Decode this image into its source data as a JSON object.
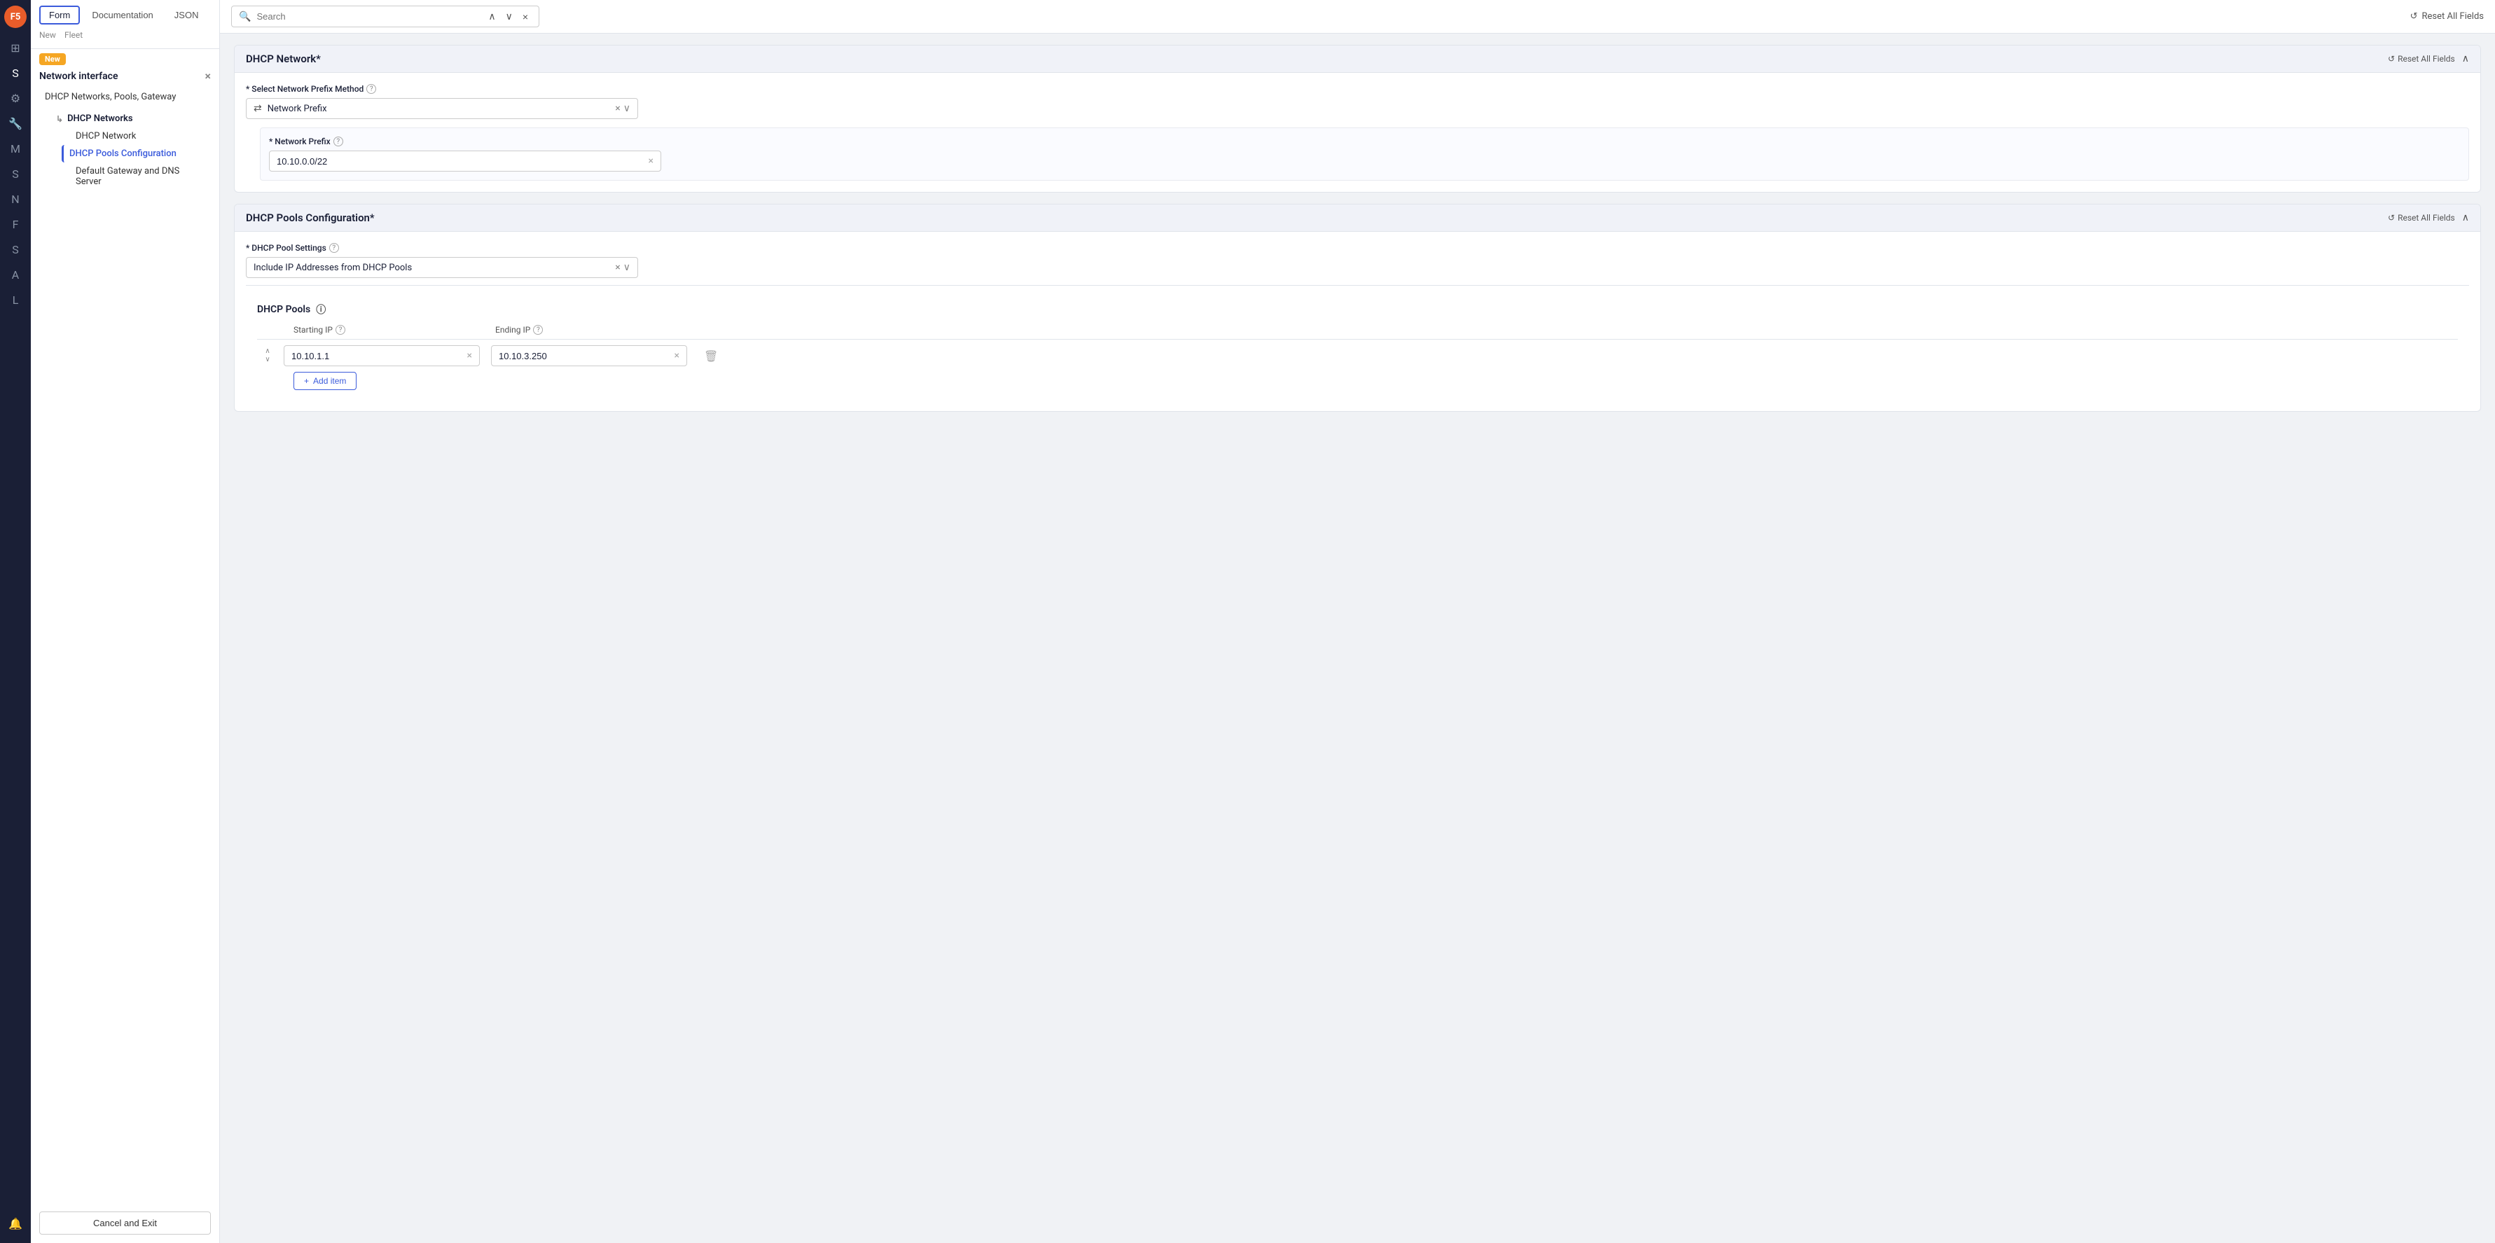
{
  "app": {
    "logo": "F5"
  },
  "sidebar": {
    "icons": [
      "⊞",
      "S",
      "⚙",
      "🔧",
      "M",
      "S",
      "N",
      "F",
      "S",
      "A",
      "L",
      "🔔"
    ]
  },
  "left_panel": {
    "tabs": [
      {
        "id": "form",
        "label": "Form",
        "active": true
      },
      {
        "id": "documentation",
        "label": "Documentation",
        "active": false
      },
      {
        "id": "json",
        "label": "JSON",
        "active": false
      }
    ],
    "breadcrumb_new": "New",
    "breadcrumb_fleet": "Fleet",
    "new_badge": "New",
    "close_icon": "×",
    "panel_title": "Network interface",
    "nav_items": [
      {
        "id": "dhcp-networks-pools",
        "label": "DHCP Networks, Pools, Gateway",
        "level": 0,
        "active": false
      },
      {
        "id": "dhcp-networks-header",
        "label": "DHCP Networks",
        "level": 0,
        "arrow": true,
        "bold": true
      },
      {
        "id": "dhcp-network",
        "label": "DHCP Network",
        "level": 1,
        "active": false
      },
      {
        "id": "dhcp-pools-config",
        "label": "DHCP Pools Configuration",
        "level": 1,
        "active": true
      },
      {
        "id": "default-gateway",
        "label": "Default Gateway and DNS Server",
        "level": 1,
        "active": false
      }
    ],
    "cancel_button": "Cancel and Exit"
  },
  "top_bar": {
    "search_placeholder": "Search",
    "search_value": "",
    "nav_up": "∧",
    "nav_down": "∨",
    "nav_close": "×",
    "reset_all_label": "Reset All Fields"
  },
  "dhcp_network_card": {
    "title": "DHCP Network*",
    "reset_label": "Reset All Fields",
    "collapse_icon": "∧",
    "select_network_prefix_label": "* Select Network Prefix Method",
    "help_icon": "?",
    "selected_method": "Network Prefix",
    "method_icon": "⇄",
    "network_prefix_label": "* Network Prefix",
    "network_prefix_value": "10.10.0.0/22"
  },
  "dhcp_pools_card": {
    "title": "DHCP Pools Configuration*",
    "reset_label": "Reset All Fields",
    "collapse_icon": "∧",
    "dhcp_pool_settings_label": "* DHCP Pool Settings",
    "help_icon": "?",
    "selected_setting": "Include IP Addresses from DHCP Pools",
    "pools_section_title": "DHCP Pools",
    "pools_help_icon": "ⓘ",
    "starting_ip_label": "Starting IP",
    "ending_ip_label": "Ending IP",
    "rows": [
      {
        "id": "row1",
        "starting_ip": "10.10.1.1",
        "ending_ip": "10.10.3.250"
      }
    ],
    "add_item_label": "Add item",
    "add_icon": "+"
  }
}
